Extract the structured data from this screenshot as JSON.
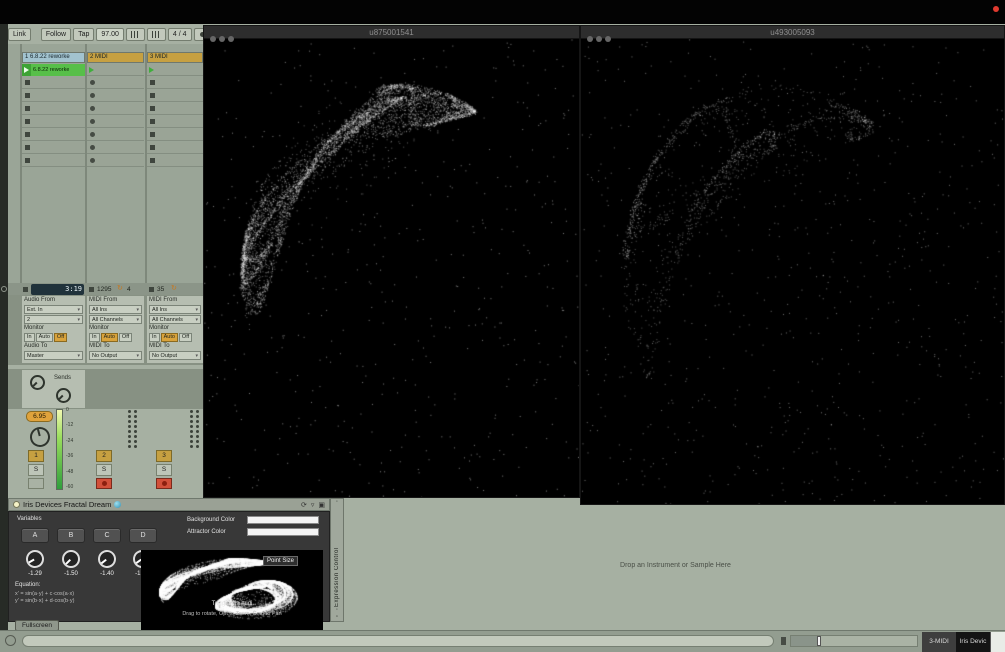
{
  "transport": {
    "link": "Link",
    "follow": "Follow",
    "tap": "Tap",
    "tempo": "97.00",
    "time_sig": "4 / 4",
    "quantize": "1"
  },
  "session": {
    "tracks": [
      {
        "header": "1 6.8.22 reworke",
        "clip": "6.8.22 reworke",
        "status": "3:19"
      },
      {
        "header": "2 MIDI",
        "status_count": "1295",
        "status_beats": "4"
      },
      {
        "header": "3 MIDI",
        "status_count": "35"
      }
    ],
    "routing_cards": [
      {
        "from_label": "Audio From",
        "from_value": "Ext. In",
        "channel": "2",
        "monitor_label": "Monitor",
        "monitor_options": [
          "In",
          "Auto",
          "Off"
        ],
        "monitor_selected": "Off",
        "to_label": "Audio To",
        "to_value": "Master"
      },
      {
        "from_label": "MIDI From",
        "from_value": "All Ins",
        "channel": "All Channels",
        "monitor_label": "Monitor",
        "monitor_options": [
          "In",
          "Auto",
          "Off"
        ],
        "monitor_selected": "Auto",
        "to_label": "MIDI To",
        "to_value": "No Output"
      },
      {
        "from_label": "MIDI From",
        "from_value": "All Ins",
        "channel": "All Channels",
        "monitor_label": "Monitor",
        "monitor_options": [
          "In",
          "Auto",
          "Off"
        ],
        "monitor_selected": "Auto",
        "to_label": "MIDI To",
        "to_value": "No Output"
      }
    ],
    "sends_label": "Sends",
    "mixer": {
      "volume_value": "6.95",
      "meter_scale": [
        "0",
        "-12",
        "-24",
        "-36",
        "-48",
        "-60"
      ],
      "track_numbers": [
        "1",
        "2",
        "3"
      ],
      "solo_label": "S"
    }
  },
  "windows": [
    {
      "title": "u875001541"
    },
    {
      "title": "u493005093"
    }
  ],
  "device": {
    "title": "Iris Devices Fractal Dream",
    "variables_label": "Variables",
    "variable_buttons": [
      "A",
      "B",
      "C",
      "D"
    ],
    "knob_values": [
      "-1.29",
      "-1.50",
      "-1.40",
      "-1.37"
    ],
    "background_color_label": "Background Color",
    "attractor_color_label": "Attractor Color",
    "point_size_label": "Point Size",
    "equation_label": "Equation:",
    "equation_line1": "x' = sin(a·y) + c·cos(a·x)",
    "equation_line2": "y' = sin(b·x) + d·cos(b·y)",
    "trigger_text": "Trigger via midi",
    "help_text": "Drag to rotate, Opt to Zoom, Cmd to Pan",
    "fullscreen_label": "Fullscreen",
    "attractor_params": {
      "a": -1.29,
      "b": -1.5,
      "c": -1.4,
      "d": -1.37
    }
  },
  "side_strip": {
    "label": "Expression Control"
  },
  "main_area": {
    "drop_text": "Drop an Instrument or Sample Here"
  },
  "status_bar": {
    "track_tab": "3-MIDI",
    "device_tab": "Iris Devic"
  }
}
